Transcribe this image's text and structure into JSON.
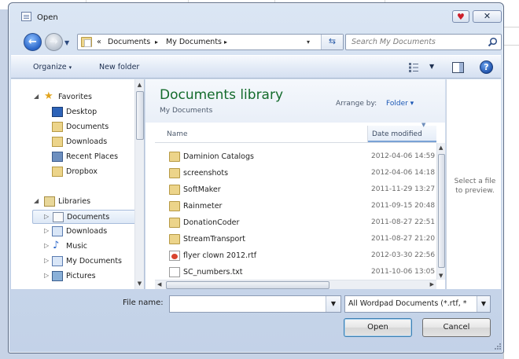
{
  "window": {
    "title": "Open",
    "close_glyph": "✕",
    "heart_glyph": "♥"
  },
  "address_bar": {
    "overflow": "«",
    "crumbs": [
      "Documents",
      "My Documents"
    ],
    "separator": "▸",
    "dropdown": "▾",
    "refresh_glyph": "⇆"
  },
  "search": {
    "placeholder": "Search My Documents"
  },
  "toolbar": {
    "organize_label": "Organize",
    "new_folder_label": "New folder",
    "caret": "▾"
  },
  "nav_pane": {
    "favorites": {
      "label": "Favorites",
      "items": [
        {
          "label": "Desktop",
          "icon": "desktop-icon"
        },
        {
          "label": "Documents",
          "icon": "folder-icon"
        },
        {
          "label": "Downloads",
          "icon": "folder-icon"
        },
        {
          "label": "Recent Places",
          "icon": "recent-places-icon"
        },
        {
          "label": "Dropbox",
          "icon": "folder-icon"
        }
      ]
    },
    "libraries": {
      "label": "Libraries",
      "items": [
        {
          "label": "Documents",
          "icon": "documents-library-icon",
          "selected": true
        },
        {
          "label": "Downloads",
          "icon": "downloads-library-icon"
        },
        {
          "label": "Music",
          "icon": "music-icon"
        },
        {
          "label": "My Documents",
          "icon": "documents-library-icon"
        },
        {
          "label": "Pictures",
          "icon": "pictures-icon"
        }
      ]
    }
  },
  "library": {
    "title": "Documents library",
    "subtitle": "My Documents",
    "arrange_label": "Arrange by:",
    "arrange_value": "Folder ▾"
  },
  "columns": {
    "name": "Name",
    "date": "Date modified"
  },
  "files": [
    {
      "name": "Daminion Catalogs",
      "date": "2012-04-06 14:59",
      "type": "folder"
    },
    {
      "name": "screenshots",
      "date": "2012-04-06 14:18",
      "type": "folder"
    },
    {
      "name": "SoftMaker",
      "date": "2011-11-29 13:27",
      "type": "folder"
    },
    {
      "name": "Rainmeter",
      "date": "2011-09-15 20:48",
      "type": "folder"
    },
    {
      "name": "DonationCoder",
      "date": "2011-08-27 22:51",
      "type": "folder"
    },
    {
      "name": "StreamTransport",
      "date": "2011-08-27 21:20",
      "type": "folder"
    },
    {
      "name": "flyer clown 2012.rtf",
      "date": "2012-03-30 22:56",
      "type": "rtf"
    },
    {
      "name": "SC_numbers.txt",
      "date": "2011-10-06 13:05",
      "type": "txt"
    }
  ],
  "preview": {
    "message": "Select a file to preview."
  },
  "bottom": {
    "file_name_label": "File name:",
    "file_name_value": "",
    "file_type": "All Wordpad Documents (*.rtf, *",
    "open_label": "Open",
    "cancel_label": "Cancel"
  },
  "colors": {
    "library_title": "#146b2c",
    "link": "#1c58b5",
    "frame": "#c9d7ea"
  }
}
